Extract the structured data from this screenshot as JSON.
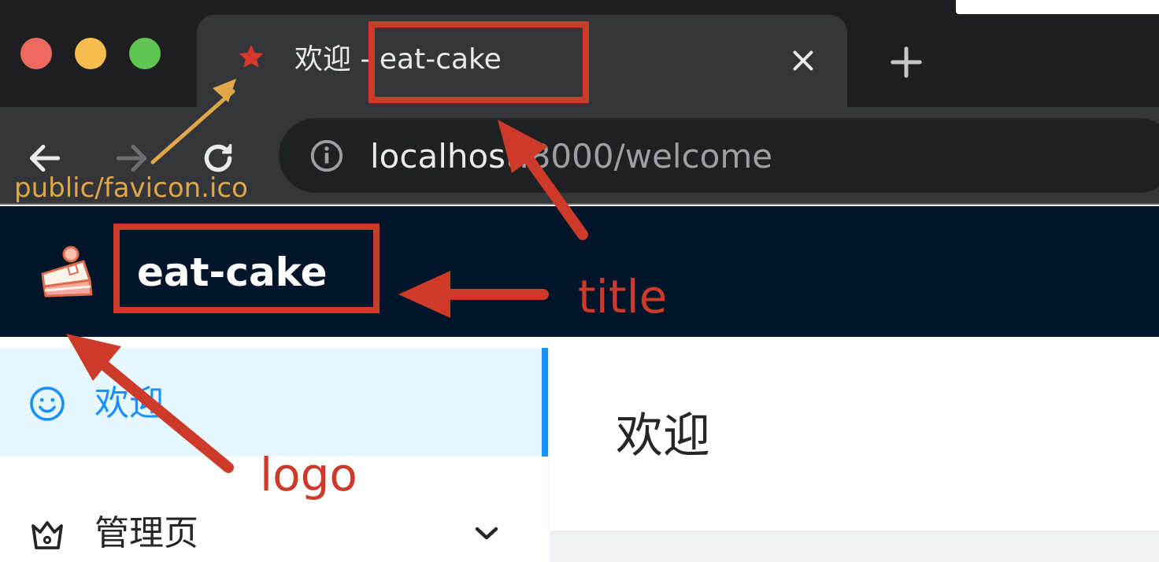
{
  "browser": {
    "tab": {
      "title": "欢迎 - eat-cake",
      "favicon": "star-icon",
      "close_icon": "close-icon"
    },
    "new_tab_icon": "plus-icon",
    "nav": {
      "back_icon": "arrow-left-icon",
      "forward_icon": "arrow-right-icon",
      "reload_icon": "reload-icon"
    },
    "address_bar": {
      "info_icon": "info-icon",
      "host": "localhost",
      "rest": ":8000/welcome"
    }
  },
  "app": {
    "header": {
      "logo_icon": "cake-icon",
      "title": "eat-cake"
    },
    "menu": {
      "items": [
        {
          "label": "欢迎",
          "icon": "smile-icon",
          "selected": true
        },
        {
          "label": "管理页",
          "icon": "crown-icon",
          "expand_icon": "chevron-down-icon"
        }
      ]
    },
    "page": {
      "title": "欢迎"
    }
  },
  "annotations": {
    "favicon_label": "public/favicon.ico",
    "title_label": "title",
    "logo_label": "logo"
  },
  "colors": {
    "browser_dark": "#1f1f22",
    "tab_bg": "#35363a",
    "header_bg": "#001529",
    "primary": "#1890ff",
    "selected_bg": "#e6f7ff",
    "annotation_red": "#cd3a2a",
    "annotation_gold": "#e0a64a"
  }
}
